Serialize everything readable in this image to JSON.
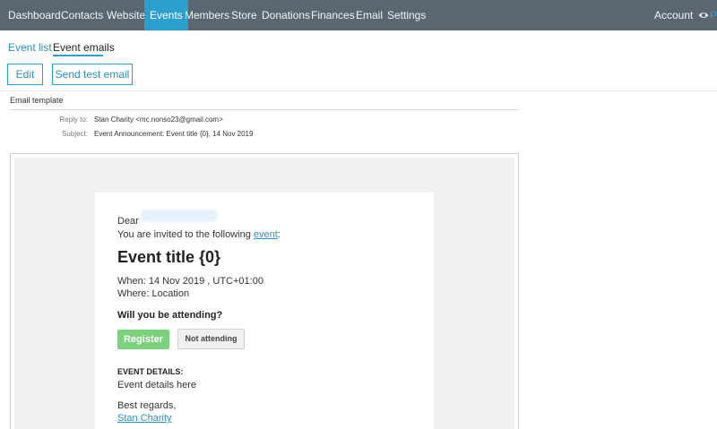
{
  "nav": {
    "items": [
      "Dashboard",
      "Contacts",
      "Website",
      "Events",
      "Members",
      "Store",
      "Donations",
      "Finances",
      "Email",
      "Settings"
    ],
    "active": "Events",
    "account": "Account",
    "preview_partial": "P",
    "colors": {
      "bar": "#5b6770",
      "active": "#2ba0cf"
    }
  },
  "subtabs": {
    "event_list": "Event list",
    "event_emails": "Event emails"
  },
  "toolbar": {
    "edit": "Edit",
    "send_test": "Send test email"
  },
  "template": {
    "title": "Email template",
    "reply_to_label": "Reply to:",
    "reply_to_value": "Stan Charity <mc.nonso23@gmail.com>",
    "subject_label": "Subject:",
    "subject_value": "Event Announcement: Event title {0}, 14 Nov 2019"
  },
  "email": {
    "dear": "Dear",
    "invite_prefix": "You are invited to the following ",
    "invite_link": "event",
    "invite_suffix": ":",
    "event_title": "Event title {0}",
    "when": "When: 14 Nov 2019 , UTC+01:00",
    "where": "Where: Location",
    "attending_q": "Will you be attending?",
    "register": "Register",
    "not_attending": "Not attending",
    "details_heading": "EVENT DETAILS:",
    "details_body": "Event details here",
    "regards": "Best regards,",
    "signature": "Stan Charity",
    "colors": {
      "register": "#7bd17c",
      "link": "#2b8fc2"
    }
  }
}
